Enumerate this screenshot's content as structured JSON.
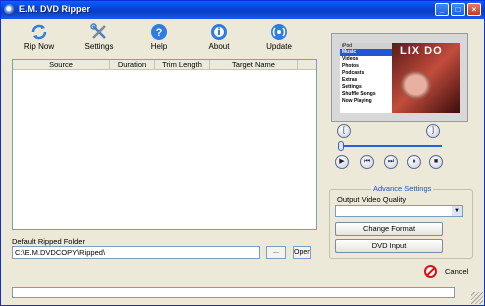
{
  "window": {
    "title": "E.M. DVD Ripper",
    "minimize": "_",
    "maximize": "□",
    "close": "×"
  },
  "toolbar": {
    "rip_now": "Rip Now",
    "settings": "Settings",
    "help": "Help",
    "about": "About",
    "update": "Update"
  },
  "list": {
    "columns": [
      "Source",
      "Duration",
      "Trim Length",
      "Target Name"
    ]
  },
  "folder": {
    "label": "Default Ripped Folder",
    "value": "C:\\E.M.DVDCOPY\\Ripped\\",
    "browse": "...",
    "open": "Open"
  },
  "preview": {
    "menu_title": "iPod",
    "menu_items": [
      "Music",
      "Videos",
      "Photos",
      "Podcasts",
      "Extras",
      "Settings",
      "Shuffle Songs",
      "Now Playing"
    ],
    "art_text": "LIX DO"
  },
  "player": {
    "mark_in": "[",
    "mark_out": "]",
    "play": "▶",
    "prev": "⏮",
    "next": "⏭",
    "pause": "⏸",
    "stop": "■",
    "seek_position": 0
  },
  "advance": {
    "title": "Advance Settings",
    "quality_label": "Output Video Quality",
    "quality_value": "",
    "change_format": "Change Format",
    "dvd_input": "DVD Input"
  },
  "cancel_label": "Cancel",
  "progress": 0
}
